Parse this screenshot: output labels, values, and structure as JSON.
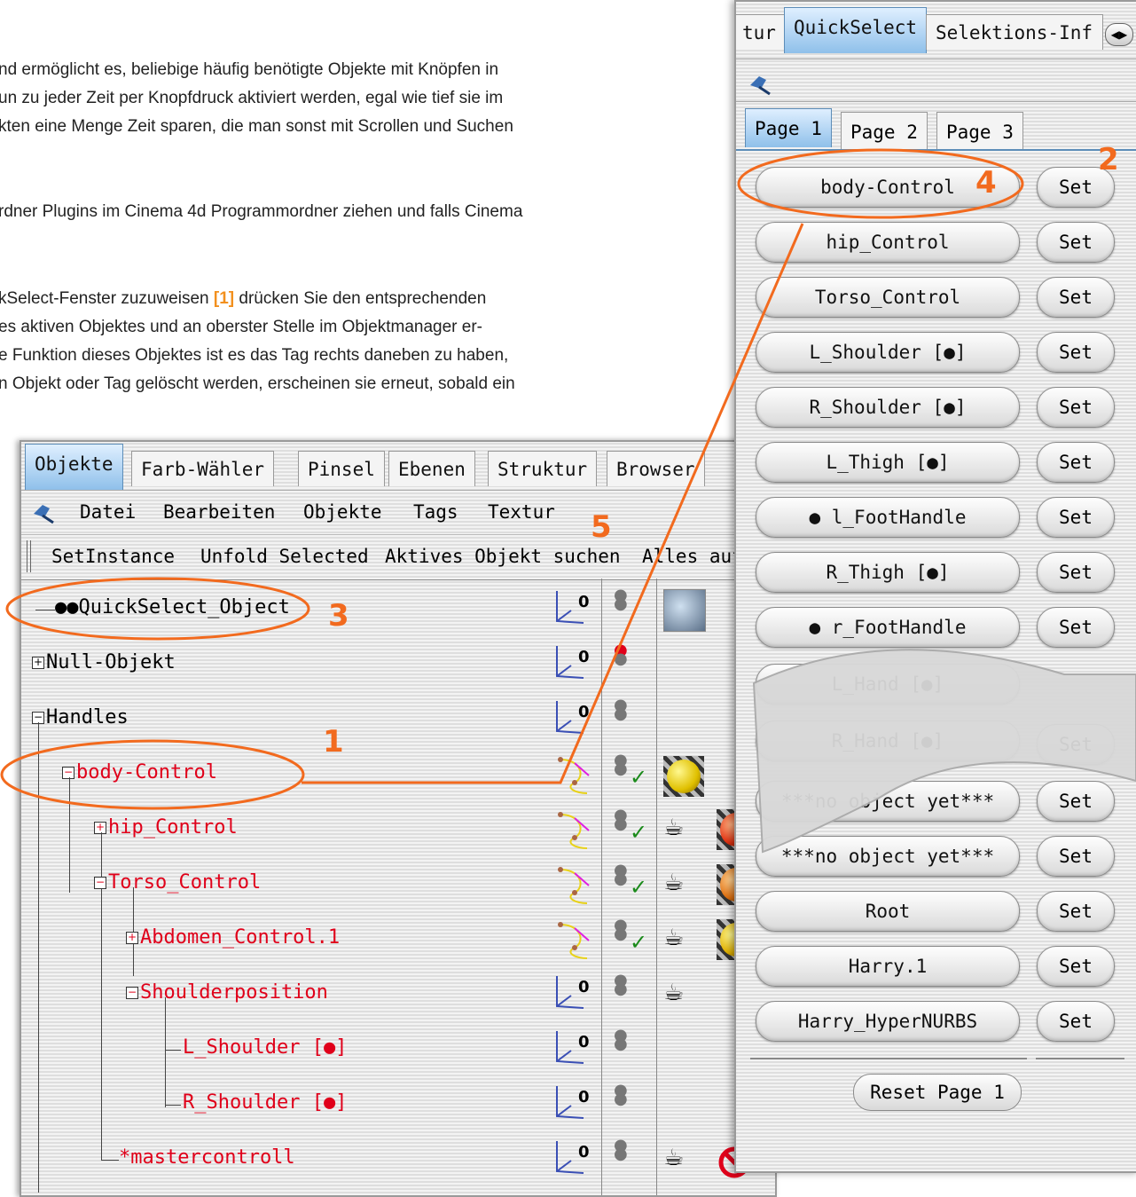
{
  "doc": {
    "lines": [
      "nd ermöglicht es, beliebige häufig benötigte Objekte mit Knöpfen in",
      "un zu jeder Zeit per Knopfdruck aktiviert werden, egal wie tief sie im",
      "kten eine Menge Zeit sparen, die man sonst mit Scrollen und Suchen",
      "rdner Plugins im Cinema 4d Programmordner ziehen und falls Cinema",
      "kSelect-Fenster zuzuweisen",
      "[1]",
      " drücken Sie den entsprechenden",
      "es aktiven Objektes und an oberster Stelle im Objektmanager er-",
      "e Funktion dieses Objektes ist es das Tag rechts daneben zu haben,",
      "n Objekt oder Tag gelöscht werden, erscheinen sie erneut, sobald ein"
    ]
  },
  "object_manager": {
    "tabs": [
      "Objekte",
      "Farb-Wähler",
      "Pinsel",
      "Ebenen",
      "Struktur",
      "Browser"
    ],
    "menu": [
      "Datei",
      "Bearbeiten",
      "Objekte",
      "Tags",
      "Textur"
    ],
    "toolbar": [
      "SetInstance",
      "Unfold Selected",
      "Aktives Objekt suchen",
      "Alles auf"
    ],
    "rows": [
      "●●QuickSelect_Object",
      "Null-Objekt",
      "Handles",
      "body-Control",
      "hip_Control",
      "Torso_Control",
      "Abdomen_Control.1",
      "Shoulderposition",
      "L_Shoulder [●]",
      "R_Shoulder [●]",
      "*mastercontroll"
    ],
    "axis_label": "0"
  },
  "quickselect": {
    "tabs": [
      "tur",
      "QuickSelect",
      "Selektions-Inf"
    ],
    "pages": [
      "Page 1",
      "Page 2",
      "Page 3"
    ],
    "buttons": [
      "body-Control",
      "hip_Control",
      "Torso_Control",
      "L_Shoulder [●]",
      "R_Shoulder [●]",
      "L_Thigh [●]",
      "● l_FootHandle",
      "R_Thigh [●]",
      "● r_FootHandle",
      "L_Hand [●]",
      "R_Hand [●]",
      "***no object yet***",
      "***no object yet***",
      "Root",
      "Harry.1",
      "Harry_HyperNURBS"
    ],
    "set_label": "Set",
    "reset_label": "Reset Page 1"
  },
  "annotations": {
    "n1": "1",
    "n2": "2",
    "n3": "3",
    "n4": "4",
    "n5": "5"
  },
  "colors": {
    "accent": "#f26a1e",
    "selected_text": "#e0001a",
    "tab_active": "#8fc0ea"
  }
}
